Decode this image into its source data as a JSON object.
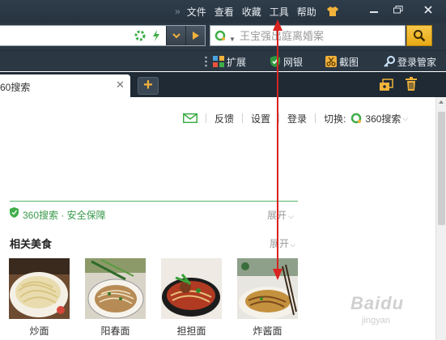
{
  "menu": {
    "items": [
      "文件",
      "查看",
      "收藏",
      "工具",
      "帮助"
    ]
  },
  "address": {
    "search_placeholder": "王宝强出庭离婚案"
  },
  "toolbar": {
    "items": [
      "扩展",
      "网银",
      "截图",
      "登录管家"
    ]
  },
  "tabs": [
    {
      "title": "60搜索"
    }
  ],
  "page": {
    "nav": {
      "feedback": "反馈",
      "settings": "设置",
      "login": "登录",
      "switch_label": "切换:",
      "engine": "360搜索"
    },
    "safe_text": "360搜索 · 安全保障",
    "safe_expand": "展开",
    "food_title": "相关美食",
    "food_expand": "展开",
    "foods": [
      "炒面",
      "阳春面",
      "担担面",
      "炸酱面"
    ]
  },
  "watermark": {
    "brand": "Baidu",
    "sub": "jingyan"
  },
  "colors": {
    "chrome_dark": "#2b3844",
    "accent_green": "#3a9a4c",
    "annotation_red": "#d9231f",
    "search_button": "#f0b62c"
  }
}
